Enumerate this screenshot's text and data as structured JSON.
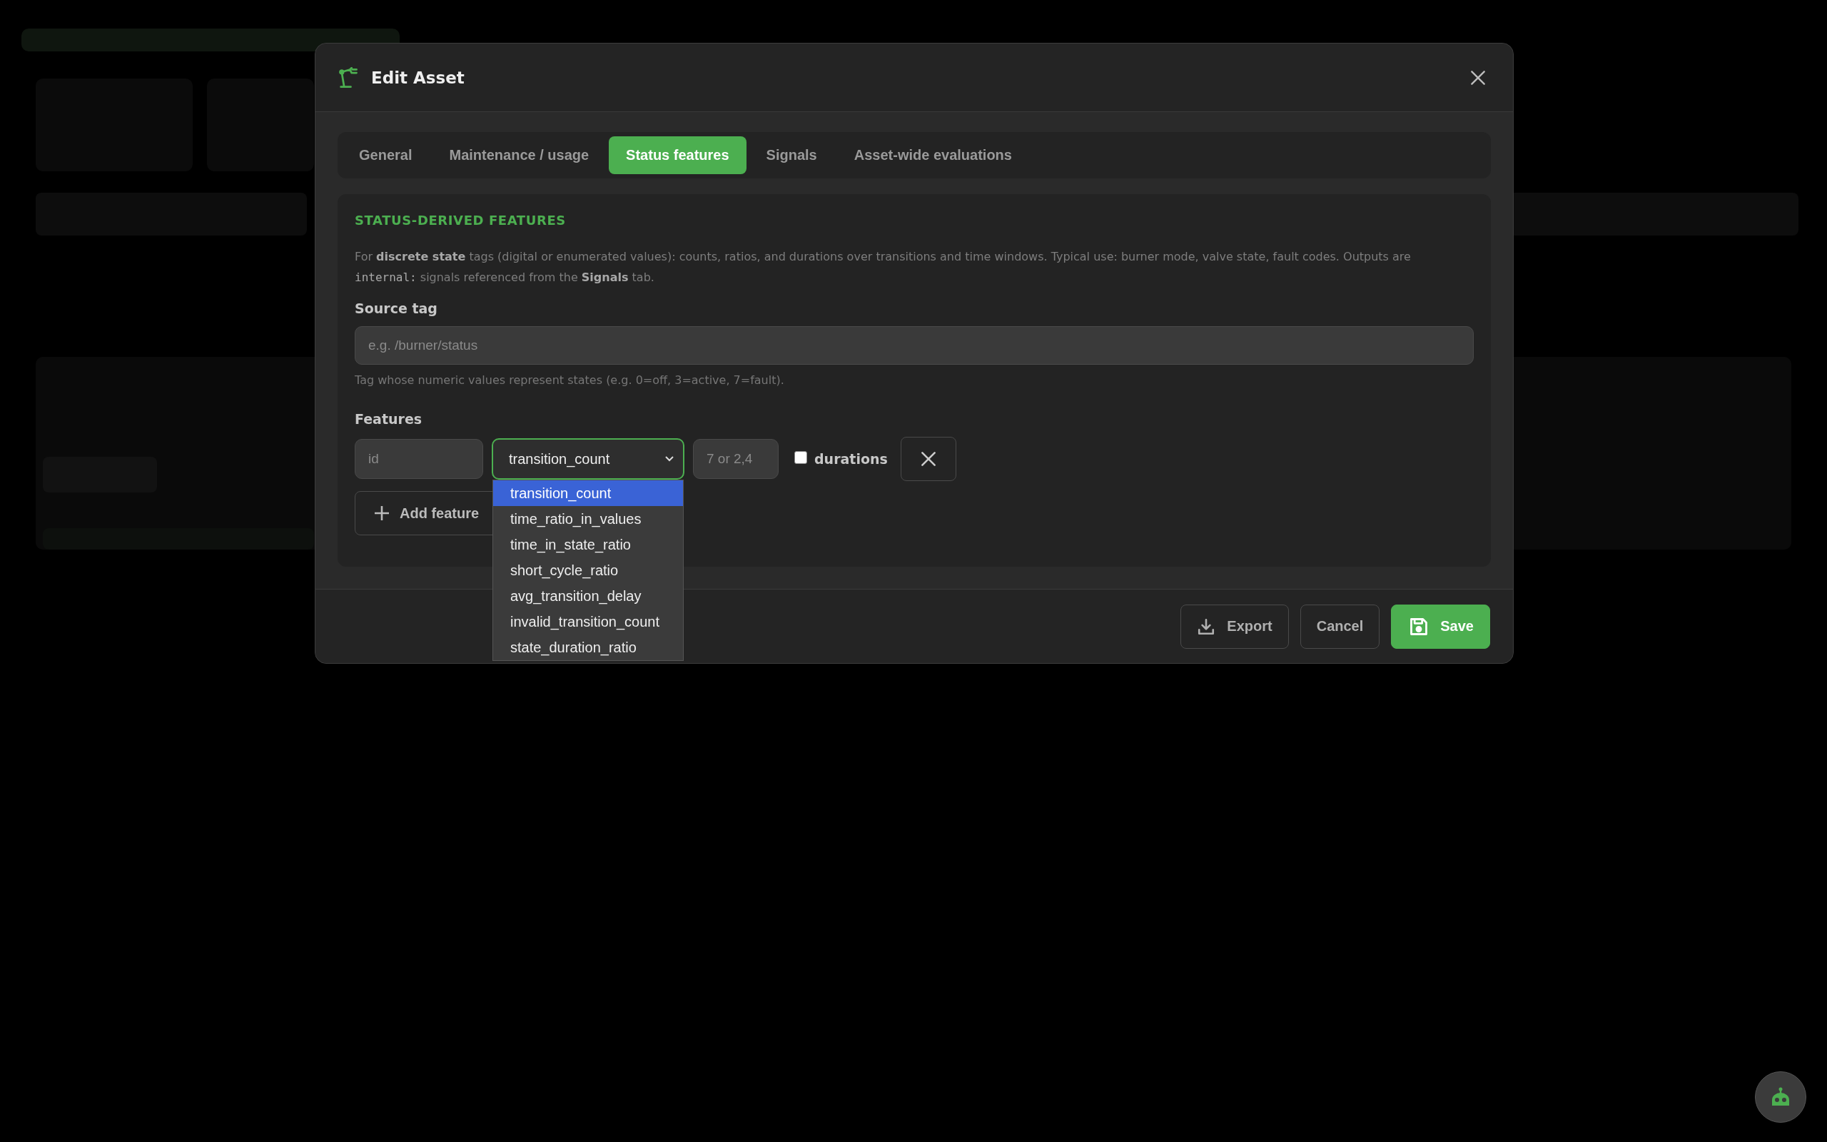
{
  "modal": {
    "title": "Edit Asset",
    "tabs": [
      {
        "label": "General",
        "selected": false
      },
      {
        "label": "Maintenance / usage",
        "selected": false
      },
      {
        "label": "Status features",
        "selected": true
      },
      {
        "label": "Signals",
        "selected": false
      },
      {
        "label": "Asset-wide evaluations",
        "selected": false
      }
    ],
    "section": {
      "heading": "STATUS-DERIVED FEATURES",
      "description": [
        {
          "kind": "plain",
          "text": "For "
        },
        {
          "kind": "bold",
          "text": "discrete state"
        },
        {
          "kind": "plain",
          "text": " tags (digital or enumerated values): counts, ratios, and durations over transitions and time windows. Typical use: burner mode, valve state, fault codes. Outputs are "
        },
        {
          "kind": "code",
          "text": "internal:"
        },
        {
          "kind": "plain",
          "text": " signals referenced from the "
        },
        {
          "kind": "bold",
          "text": "Signals"
        },
        {
          "kind": "plain",
          "text": " tab."
        }
      ],
      "source_tag": {
        "label": "Source tag",
        "placeholder": "e.g. /burner/status",
        "hint": "Tag whose numeric values represent states (e.g. 0=off, 3=active, 7=fault)."
      },
      "features": {
        "label": "Features",
        "rows": [
          {
            "id_placeholder": "id",
            "type": "transition_count",
            "values_placeholder": "7 or 2,4",
            "durations": {
              "label": "durations",
              "checked": false
            }
          }
        ],
        "add_button": "Add feature"
      },
      "dropdown": {
        "options": [
          {
            "label": "transition_count",
            "selected": true
          },
          {
            "label": "time_ratio_in_values",
            "selected": false
          },
          {
            "label": "time_in_state_ratio",
            "selected": false
          },
          {
            "label": "short_cycle_ratio",
            "selected": false
          },
          {
            "label": "avg_transition_delay",
            "selected": false
          },
          {
            "label": "invalid_transition_count",
            "selected": false
          },
          {
            "label": "state_duration_ratio",
            "selected": false
          }
        ]
      }
    },
    "footer": {
      "buttons": [
        {
          "label": "Export",
          "kind": "export"
        },
        {
          "label": "Cancel",
          "kind": "cancel"
        },
        {
          "label": "Save",
          "kind": "save"
        }
      ]
    }
  }
}
